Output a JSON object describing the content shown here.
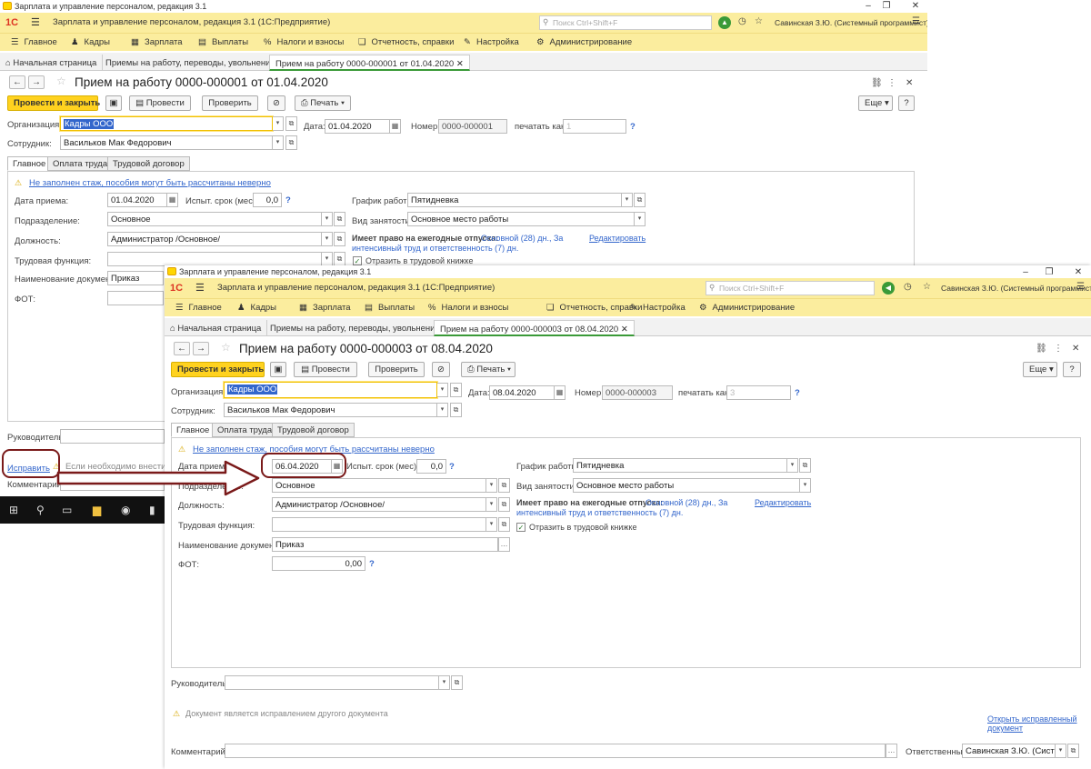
{
  "w1": {
    "window_title": "Зарплата и управление персоналом, редакция 3.1",
    "app_title": "Зарплата и управление персоналом, редакция 3.1  (1С:Предприятие)",
    "search_placeholder": "Поиск Ctrl+Shift+F",
    "user": "Савинская З.Ю. (Системный программист)",
    "menu": [
      "Главное",
      "Кадры",
      "Зарплата",
      "Выплаты",
      "Налоги и взносы",
      "Отчетность, справки",
      "Настройка",
      "Администрирование"
    ],
    "tabs": [
      "Начальная страница",
      "Приемы на работу, переводы, увольнения",
      "Прием на работу 0000-000001 от 01.04.2020"
    ],
    "doc_title": "Прием на работу 0000-000001 от 01.04.2020",
    "btn_post_close": "Провести и закрыть",
    "btn_post": "Провести",
    "btn_check": "Проверить",
    "btn_print": "Печать",
    "btn_more": "Еще",
    "btn_help": "?",
    "org_label": "Организация:",
    "org_value": "Кадры ООО",
    "date_label": "Дата:",
    "date_value": "01.04.2020",
    "num_label": "Номер:",
    "num_value": "0000-000001",
    "print_as_label": "печатать как:",
    "print_as_value": "1",
    "emp_label": "Сотрудник:",
    "emp_value": "Васильков Мак Федорович",
    "form_tabs": [
      "Главное",
      "Оплата труда",
      "Трудовой договор"
    ],
    "warn_text": "Не заполнен стаж, пособия могут быть рассчитаны неверно",
    "hire_date_label": "Дата приема:",
    "hire_date_value": "01.04.2020",
    "trial_label": "Испыт. срок (мес):",
    "trial_value": "0,0",
    "schedule_label": "График работы:",
    "schedule_value": "Пятидневка",
    "dept_label": "Подразделение:",
    "dept_value": "Основное",
    "empl_type_label": "Вид занятости:",
    "empl_type_value": "Основное место работы",
    "position_label": "Должность:",
    "position_value": "Администратор /Основное/",
    "vacation_label": "Имеет право на ежегодные отпуска:",
    "vacation_value1": "Основной (28) дн., За",
    "vacation_value2": "интенсивный труд и ответственность (7) дн.",
    "edit_link": "Редактировать",
    "func_label": "Трудовая функция:",
    "workbook_label": "Отразить в трудовой книжке",
    "docname_label": "Наименование документа:",
    "docname_value": "Приказ",
    "fot_label": "ФОТ:",
    "head_label": "Руководитель:",
    "fix_link": "Исправить",
    "fix_hint": "Если необходимо внести ис",
    "comment_label": "Комментарий:"
  },
  "w2": {
    "window_title": "Зарплата и управление персоналом, редакция 3.1",
    "app_title": "Зарплата и управление персоналом, редакция 3.1  (1С:Предприятие)",
    "search_placeholder": "Поиск Ctrl+Shift+F",
    "user": "Савинская З.Ю. (Системный программист)",
    "menu": [
      "Главное",
      "Кадры",
      "Зарплата",
      "Выплаты",
      "Налоги и взносы",
      "Отчетность, справки",
      "Настройка",
      "Администрирование"
    ],
    "tabs": [
      "Начальная страница",
      "Приемы на работу, переводы, увольнения",
      "Прием на работу 0000-000003 от 08.04.2020"
    ],
    "doc_title": "Прием на работу 0000-000003 от 08.04.2020",
    "btn_post_close": "Провести и закрыть",
    "btn_post": "Провести",
    "btn_check": "Проверить",
    "btn_print": "Печать",
    "btn_more": "Еще",
    "btn_help": "?",
    "org_label": "Организация:",
    "org_value": "Кадры ООО",
    "date_label": "Дата:",
    "date_value": "08.04.2020",
    "num_label": "Номер:",
    "num_value": "0000-000003",
    "print_as_label": "печатать как:",
    "print_as_value": "3",
    "emp_label": "Сотрудник:",
    "emp_value": "Васильков Мак Федорович",
    "form_tabs": [
      "Главное",
      "Оплата труда",
      "Трудовой договор"
    ],
    "warn_text": "Не заполнен стаж, пособия могут быть рассчитаны неверно",
    "hire_date_label": "Дата приема:",
    "hire_date_value": "06.04.2020",
    "trial_label": "Испыт. срок (мес):",
    "trial_value": "0,0",
    "schedule_label": "График работы:",
    "schedule_value": "Пятидневка",
    "dept_label": "Подразделение:",
    "dept_value": "Основное",
    "empl_type_label": "Вид занятости:",
    "empl_type_value": "Основное место работы",
    "position_label": "Должность:",
    "position_value": "Администратор /Основное/",
    "vacation_label": "Имеет право на ежегодные отпуска:",
    "vacation_value1": "Основной (28) дн., За",
    "vacation_value2": "интенсивный труд и ответственность (7) дн.",
    "edit_link": "Редактировать",
    "func_label": "Трудовая функция:",
    "workbook_label": "Отразить в трудовой книжке",
    "docname_label": "Наименование документа:",
    "docname_value": "Приказ",
    "fot_label": "ФОТ:",
    "fot_value": "0,00",
    "head_label": "Руководитель:",
    "correction_note": "Документ является исправлением другого документа",
    "open_fixed_link1": "Открыть исправленный",
    "open_fixed_link2": "документ",
    "comment_label": "Комментарий:",
    "responsible_label": "Ответственный:",
    "responsible_value": "Савинская З.Ю. (Систем"
  }
}
